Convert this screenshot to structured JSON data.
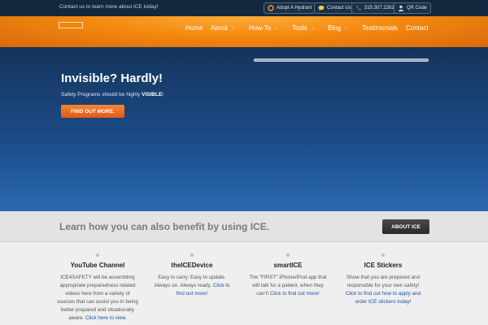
{
  "topbar": {
    "message": "Contact us to learn more about ICE today!",
    "buttons": [
      {
        "label": "Adopt A Hydrant",
        "icon": "hydrant-icon",
        "color": "#f0a020"
      },
      {
        "label": "Contact Us",
        "icon": "chat-icon",
        "color": "#f2c84a"
      },
      {
        "label": "315.307.2281",
        "icon": "phone-icon",
        "color": "#4caf50"
      },
      {
        "label": "QR Code",
        "icon": "user-icon",
        "color": "#c9c9c9"
      }
    ]
  },
  "nav": {
    "items": [
      {
        "label": "Home",
        "dropdown": false
      },
      {
        "label": "About",
        "dropdown": true
      },
      {
        "label": "How-To",
        "dropdown": true
      },
      {
        "label": "Tools",
        "dropdown": true
      },
      {
        "label": "Blog",
        "dropdown": true
      },
      {
        "label": "Testimonials",
        "dropdown": false
      },
      {
        "label": "Contact",
        "dropdown": false
      }
    ]
  },
  "hero": {
    "title": "Invisible? Hardly!",
    "subtitle_pre": "Safety Programs should be highly ",
    "subtitle_emph": "VISIBLE",
    "subtitle_post": "!",
    "button": "FIND OUT MORE."
  },
  "band": {
    "text": "Learn how you can also benefit by using ICE.",
    "button": "ABOUT ICE"
  },
  "features": [
    {
      "title": "YouTube Channel",
      "desc": "ICE4SAFETY will be assembling appropriate preparedness related videos here from a variety of sources that can assist you in being better prepared and situationally aware.",
      "link": "Click here to view."
    },
    {
      "title": "theICEDevice",
      "desc": "Easy to carry. Easy to update. Always on. Always ready.",
      "link": "Click to find out more!"
    },
    {
      "title": "smartICE",
      "desc": "The \"FIRST\" iPhone/iPod app that will talk for a patient, when they can't!",
      "link": "Click to find out more!"
    },
    {
      "title": "ICE Stickers",
      "desc": "Show that you are prepared and responsible for your own safety!",
      "link": "Click to find out how to apply and order ICE stickers today!"
    }
  ],
  "colors": {
    "header_orange": "#f48a10",
    "hero_blue": "#1b4b85",
    "cta_orange": "#e0591a",
    "link_blue": "#1d4f9c"
  }
}
